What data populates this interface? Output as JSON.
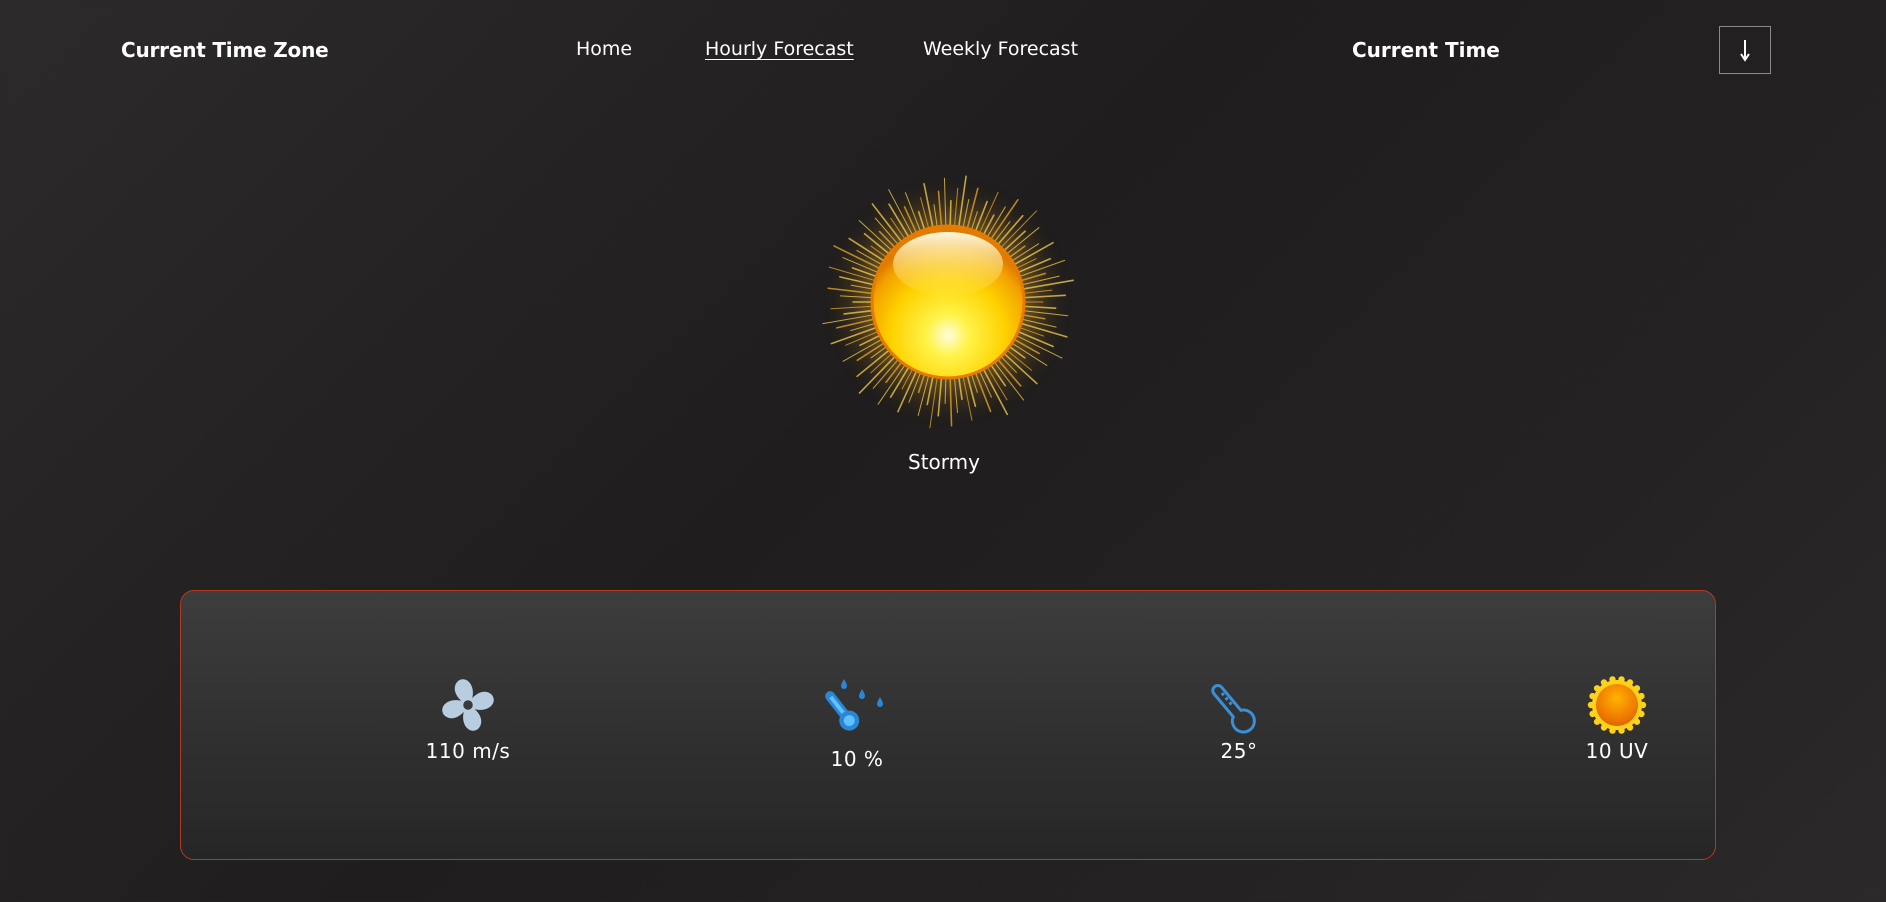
{
  "header": {
    "brand": "Current Time Zone",
    "nav": [
      {
        "label": "Home"
      },
      {
        "label": "Hourly Forecast"
      },
      {
        "label": "Weekly Forecast"
      }
    ],
    "current_time_label": "Current Time",
    "scroll_button_glyph": "↓",
    "scroll_button_icon": "arrow-down-icon"
  },
  "hero": {
    "icon": "sun-icon",
    "condition": "Stormy"
  },
  "stats": {
    "wind": {
      "icon": "fan-icon",
      "value": "110 m/s"
    },
    "humidity": {
      "icon": "thermometer-droplets-icon",
      "value": "10 %"
    },
    "temperature": {
      "icon": "thermometer-icon",
      "value": "25°"
    },
    "uv": {
      "icon": "sun-badge-icon",
      "value": "10 UV"
    }
  },
  "colors": {
    "panel_border": "#b5391f",
    "icon_blue": "#3aa3e8",
    "sun_yellow": "#ffd21a",
    "sun_orange": "#f08a00"
  }
}
